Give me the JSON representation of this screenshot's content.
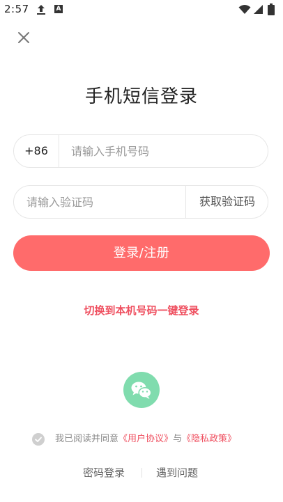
{
  "status_bar": {
    "time": "2:57",
    "icons": [
      "upload-icon",
      "notification-a-icon",
      "wifi-icon",
      "signal-icon",
      "battery-icon"
    ]
  },
  "header": {
    "close_icon": "close-icon"
  },
  "title": "手机短信登录",
  "phone": {
    "country_code": "+86",
    "placeholder": "请输入手机号码",
    "value": ""
  },
  "code": {
    "placeholder": "请输入验证码",
    "value": "",
    "get_code_label": "获取验证码"
  },
  "login_button": "登录/注册",
  "switch_link": "切换到本机号码一键登录",
  "third_party": {
    "wechat_icon": "wechat-icon"
  },
  "agreement": {
    "prefix": "我已阅读并同意",
    "user_agreement": "《用户协议》",
    "conjunction": "与",
    "privacy_policy": "《隐私政策》",
    "checked": false
  },
  "bottom_links": {
    "password_login": "密码登录",
    "help": "遇到问题"
  },
  "colors": {
    "accent": "#ff6b6b",
    "link": "#ef4f5f",
    "wechat": "#80dcae",
    "border": "#e6e6e6",
    "placeholder": "#9a9a9a"
  }
}
